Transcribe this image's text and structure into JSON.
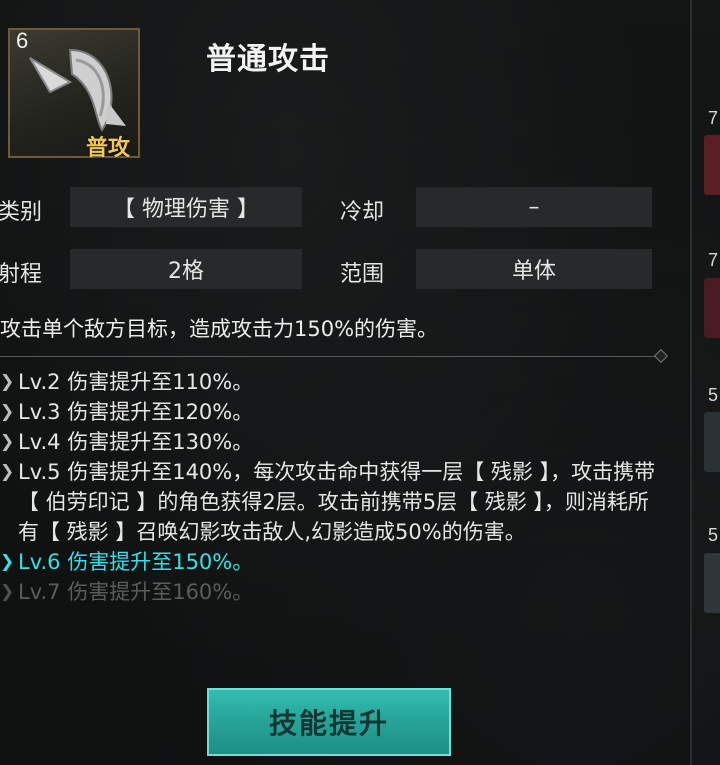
{
  "skill": {
    "level": "6",
    "type_badge": "普攻",
    "title": "普通攻击"
  },
  "stats": {
    "category_label": "类别",
    "category_value": "【 物理伤害 】",
    "cooldown_label": "冷却",
    "cooldown_value": "–",
    "range_label": "射程",
    "range_value": "2格",
    "area_label": "范围",
    "area_value": "单体"
  },
  "description": "攻击单个敌方目标，造成攻击力150%的伤害。",
  "levels": [
    {
      "text": "Lv.2 伤害提升至110%。",
      "state": "unlocked"
    },
    {
      "text": "Lv.3 伤害提升至120%。",
      "state": "unlocked"
    },
    {
      "text": "Lv.4 伤害提升至130%。",
      "state": "unlocked"
    },
    {
      "text": "Lv.5 伤害提升至140%，每次攻击命中获得一层【 残影 】，攻击携带【 伯劳印记 】的角色获得2层。攻击前携带5层【 残影 】，则消耗所有【 残影 】召唤幻影攻击敌人,幻影造成50%的伤害。",
      "state": "unlocked"
    },
    {
      "text": "Lv.6 伤害提升至150%。",
      "state": "current"
    },
    {
      "text": "Lv.7 伤害提升至160%。",
      "state": "locked"
    }
  ],
  "upgrade_button": "技能提升",
  "side_cards": [
    {
      "num": "7"
    },
    {
      "num": "7"
    },
    {
      "num": "5"
    },
    {
      "num": "5"
    }
  ],
  "colors": {
    "current_level": "#35e0e6",
    "button": "#26a398",
    "badge": "#f0c75a"
  }
}
